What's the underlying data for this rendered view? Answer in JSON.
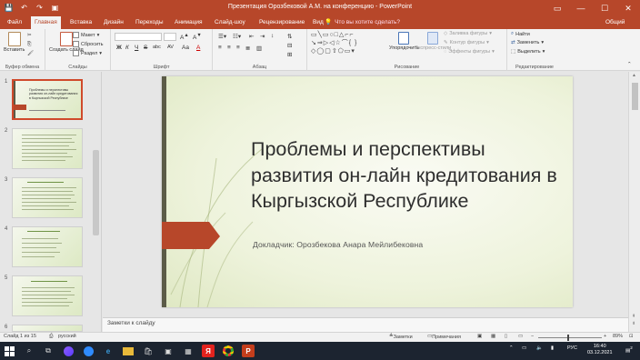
{
  "window": {
    "title": "Презентация Орозбековой А.М. на конференцию - PowerPoint",
    "controls": {
      "minimize": "—",
      "maximize": "☐",
      "close": "✕",
      "ribbon_display": "▭"
    }
  },
  "qat": {
    "save": "💾",
    "undo": "↶",
    "redo": "↷",
    "start": "▣"
  },
  "tabs": [
    "Файл",
    "Главная",
    "Вставка",
    "Дизайн",
    "Переходы",
    "Анимация",
    "Слайд-шоу",
    "Рецензирование",
    "Вид"
  ],
  "active_tab": "Главная",
  "tell_me": {
    "icon": "💡",
    "text": "Что вы хотите сделать?"
  },
  "share": "Общий доступ",
  "ribbon": {
    "clipboard": {
      "label": "Буфер обмена",
      "paste": "Вставить"
    },
    "slides": {
      "label": "Слайды",
      "new_slide": "Создать слайд",
      "layout": "Макет",
      "reset": "Сбросить",
      "section": "Раздел"
    },
    "font": {
      "label": "Шрифт",
      "font_name": "",
      "font_size": "",
      "bold": "Ж",
      "italic": "К",
      "underline": "Ч",
      "strike": "S",
      "shadow": "abc",
      "spacing": "AV",
      "case": "Aa",
      "color": "A"
    },
    "paragraph": {
      "label": "Абзац"
    },
    "drawing": {
      "label": "Рисование",
      "arrange": "Упорядочить",
      "quick_styles": "Экспресс-стили",
      "fill": "Заливка фигуры",
      "outline": "Контур фигуры",
      "effects": "Эффекты фигуры"
    },
    "editing": {
      "label": "Редактирование",
      "find": "Найти",
      "replace": "Заменить",
      "select": "Выделить"
    }
  },
  "slide_thumbnails": [
    {
      "num": "1",
      "title": "Проблемы и перспективы развития он-лайн кредитования в Кыргызской Республике"
    },
    {
      "num": "2"
    },
    {
      "num": "3"
    },
    {
      "num": "4"
    },
    {
      "num": "5"
    },
    {
      "num": "6"
    }
  ],
  "slide": {
    "title": "Проблемы и перспективы развития  он-лайн кредитования в Кыргызской Республике",
    "subtitle": "Докладчик: Орозбекова Анара Мейлибековна"
  },
  "notes_placeholder": "Заметки к слайду",
  "status": {
    "slide_info": "Слайд 1 из 15",
    "language": "русский",
    "notes_btn": "Заметки",
    "comments_btn": "Примечания",
    "zoom": "89%"
  },
  "taskbar": {
    "start_icon": "windows-logo",
    "lang": "РУС",
    "time": "16:40",
    "date": "03.12.2021",
    "notification_count": "2"
  }
}
